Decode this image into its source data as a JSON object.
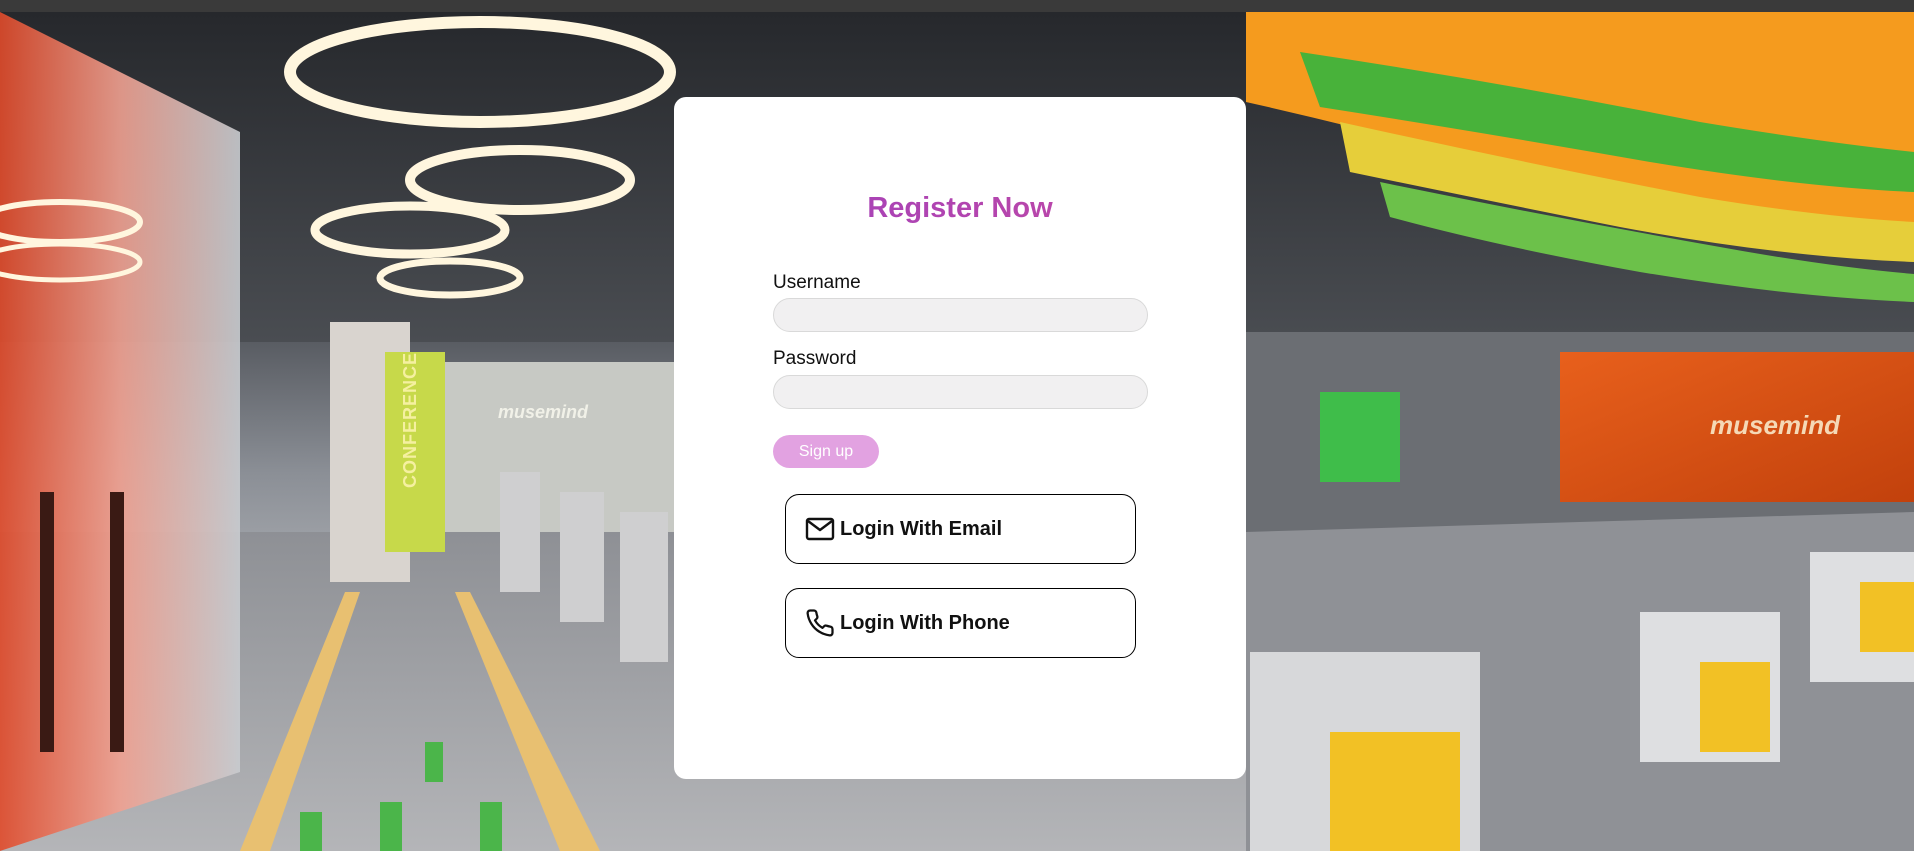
{
  "form": {
    "title": "Register Now",
    "username_label": "Username",
    "username_value": "",
    "password_label": "Password",
    "password_value": "",
    "signup_label": "Sign up"
  },
  "social": {
    "email_label": "Login With Email",
    "email_icon": "mail-icon",
    "phone_label": "Login With Phone",
    "phone_icon": "phone-icon"
  },
  "background": {
    "brand_text": "musemind",
    "sign_text": "CONFERENCE"
  },
  "colors": {
    "title_gradient_start": "#9b3fc0",
    "title_gradient_end": "#c84aa0",
    "signup_bg": "#e2a2e1",
    "input_bg": "#f1f0f1"
  }
}
